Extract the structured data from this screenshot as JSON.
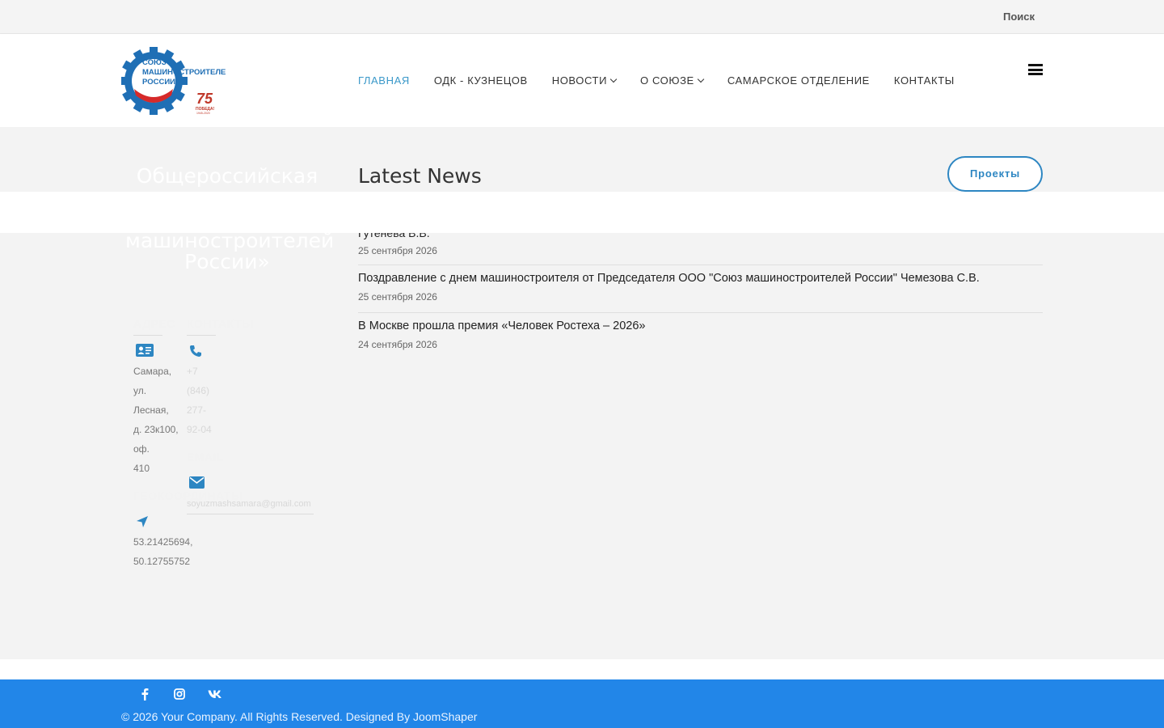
{
  "topbar": {
    "search_label": "Поиск"
  },
  "logo": {
    "line1": "СОЮЗ",
    "line2": "МАШИНОСТРОИТЕЛЕЙ",
    "line3": "РОССИИ",
    "badge_number": "75",
    "badge_text": "ПОБЕДА!",
    "badge_years": "1945-2020"
  },
  "nav": {
    "items": [
      {
        "label": "ГЛАВНАЯ"
      },
      {
        "label": "ОДК - КУЗНЕЦОВ"
      },
      {
        "label": "НОВОСТИ"
      },
      {
        "label": "О СОЮЗЕ"
      },
      {
        "label": "САМАРСКОЕ ОТДЕЛЕНИЕ"
      },
      {
        "label": "КОНТАКТЫ"
      }
    ]
  },
  "sidebar": {
    "title_line1": "Общероссийская",
    "title_line3": "машиностроителей",
    "title_line4": "России»",
    "address": {
      "heading": "АДРЕС",
      "lines": [
        "Самара,",
        "ул.",
        "Лесная,",
        "д. 23к100,",
        "оф.",
        "410"
      ]
    },
    "contacts": {
      "heading": "КОНТАКТЫ",
      "phone_lines": [
        "+7",
        "(846)",
        "277-",
        "92-04"
      ]
    },
    "email": {
      "heading": "EMAIL",
      "value": "soyuzmashsamara@gmail.com"
    },
    "geo": {
      "heading": "ГЕОКООРДИНАТЫ",
      "lines": [
        "53.21425694,",
        "50.12755752"
      ]
    }
  },
  "news": {
    "heading": "Latest News",
    "projects_button": "Проекты",
    "partial_title": "Гутенева В.В.",
    "items": [
      {
        "date": "25 сентября 2026"
      },
      {
        "title": "Поздравление с днем машиностроителя от Председателя ООО \"Союз машиностроителей России\" Чемезова С.В.",
        "date": "25 сентября 2026"
      },
      {
        "title": "В Москве прошла премия «Человек Ростеха – 2026»",
        "date": "24 сентября 2026"
      }
    ]
  },
  "footer": {
    "social": [
      "facebook-icon",
      "instagram-icon",
      "vk-icon"
    ],
    "copyright": "© 2026 Your Company. All Rights Reserved. Designed By JoomShaper"
  },
  "colors": {
    "accent": "#2d86c2",
    "nav_active": "#3a98c9",
    "footer_bg": "#2286e8"
  }
}
